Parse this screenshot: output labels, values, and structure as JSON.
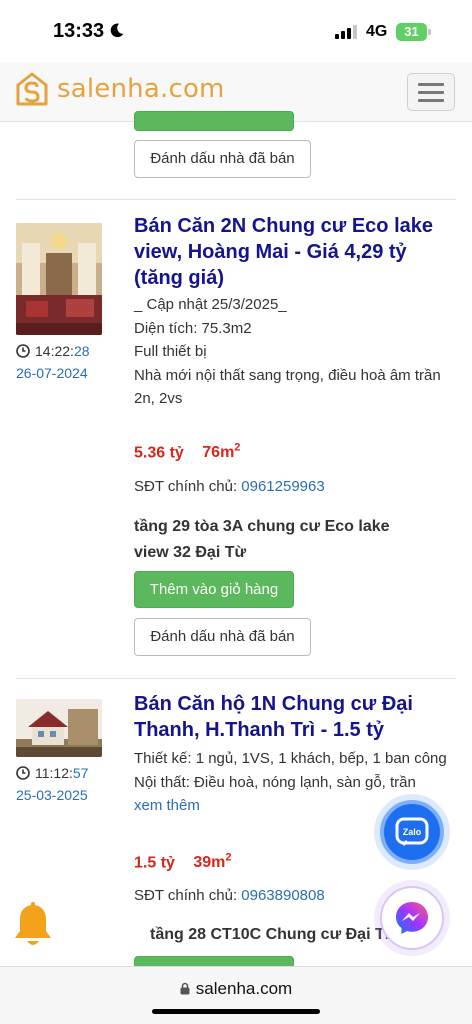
{
  "status_bar": {
    "time": "13:33",
    "network": "4G",
    "battery": "31"
  },
  "header": {
    "logo_text": "salenha.com",
    "menu_icon": "hamburger-icon",
    "brand_color": "#e6a23c"
  },
  "top_partial": {
    "mark_sold_label": "Đánh dấu nhà đã bán"
  },
  "listings": [
    {
      "title": "Bán Căn 2N Chung cư Eco lake view, Hoàng Mai - Giá 4,29 tỷ (tăng giá)",
      "time_main": "14:22:",
      "time_sec": "28",
      "date": "26-07-2024",
      "desc_lines": [
        "_ Cập nhật 25/3/2025_",
        "Diện tích: 75.3m2",
        "Full thiết bị",
        "Nhà mới nội thất sang trọng, điều hoà âm trần",
        "2n, 2vs"
      ],
      "price": "5.36 tỷ",
      "area": "76m",
      "area_sup": "2",
      "phone_label": "SĐT chính chủ: ",
      "phone": "0961259963",
      "address": "tầng 29 tòa 3A chung cư Eco lake view 32 Đại Từ",
      "add_cart_label": "Thêm vào giỏ hàng",
      "mark_sold_label": "Đánh dấu nhà đã bán"
    },
    {
      "title": "Bán Căn hộ 1N Chung cư Đại Thanh, H.Thanh Trì - 1.5 tỷ",
      "time_main": "11:12:",
      "time_sec": "57",
      "date": "25-03-2025",
      "desc_lines": [
        "Thiết kế: 1 ngủ, 1VS, 1 khách, bếp, 1 ban công",
        "Nội thất: Điều hoà, nóng lạnh, sàn gỗ, trần"
      ],
      "more_label": "xem thêm",
      "price": "1.5 tỷ",
      "area": "39m",
      "area_sup": "2",
      "phone_label": "SĐT chính chủ: ",
      "phone": "0963890808",
      "address": "tầng 28 CT10C Chung cư Đại Thanh"
    }
  ],
  "floating": {
    "zalo_label": "Zalo"
  },
  "browser": {
    "url": "salenha.com"
  },
  "colors": {
    "title": "#14148f",
    "price": "#d9261c",
    "link": "#2a6db5",
    "button": "#5cb85c"
  }
}
